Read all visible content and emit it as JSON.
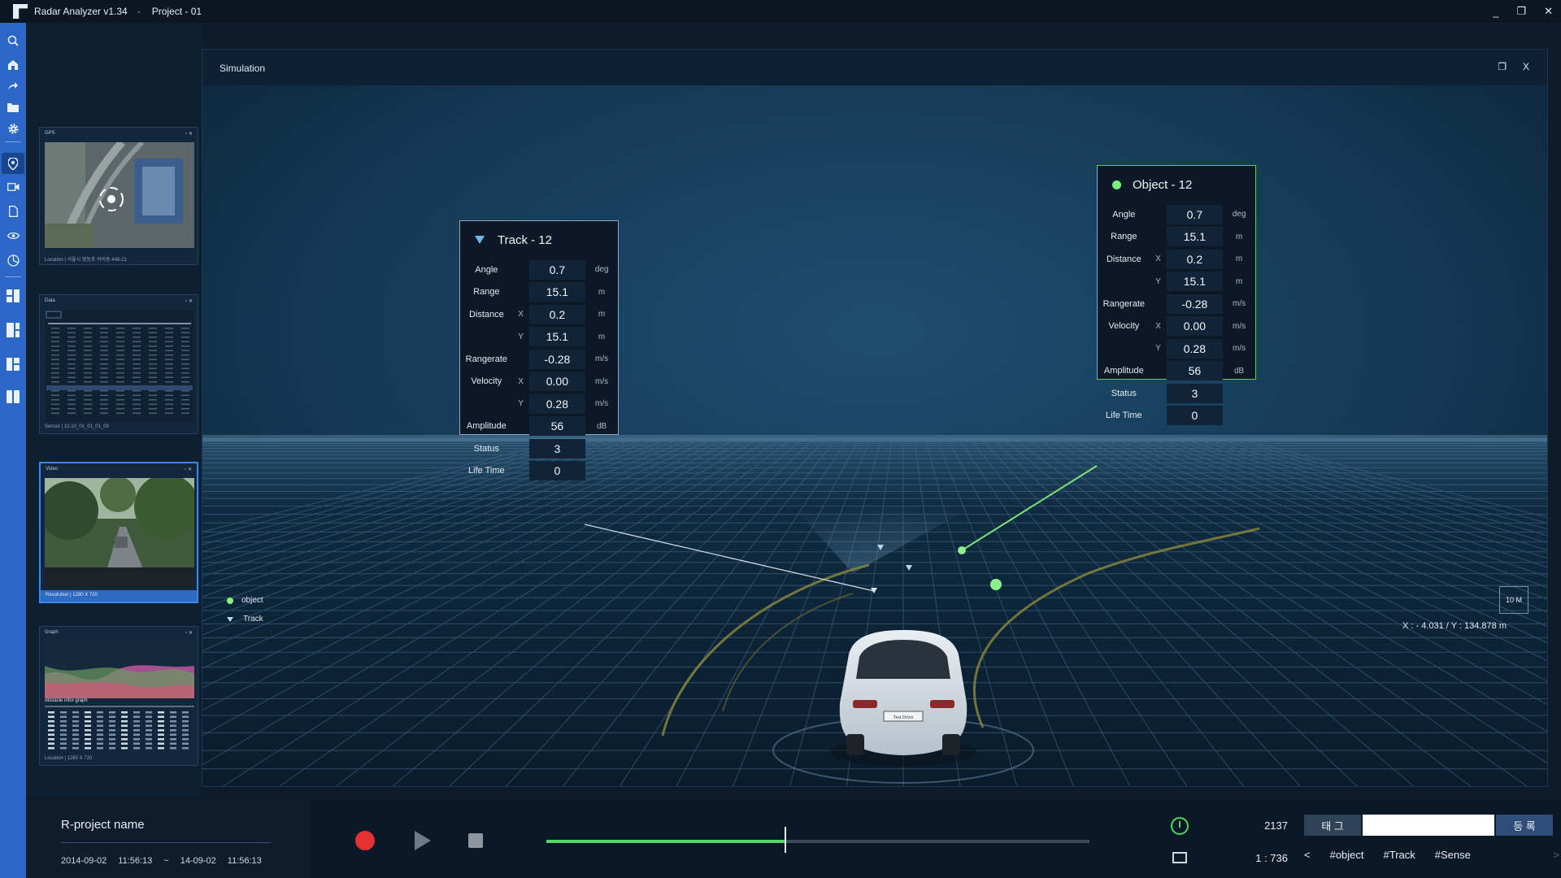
{
  "app": {
    "title": "Radar Analyzer v1.34",
    "separator": "-",
    "project": "Project - 01",
    "window_buttons": {
      "minimize": "_",
      "restore": "❐",
      "close": "✕"
    }
  },
  "rail": {
    "icons": [
      "search-icon",
      "home-icon",
      "share-icon",
      "folder-icon",
      "gear-icon",
      "location-pin-icon",
      "video-camera-icon",
      "document-icon",
      "eye-icon",
      "chart-icon",
      "layout-grid-icon",
      "layout-split-icon",
      "layout-tiles-icon",
      "layout-columns-icon"
    ],
    "active": "location-pin-icon"
  },
  "thumbnails": {
    "gps": {
      "title": "GPS",
      "footer": "Location  |  서울시 영등포 여의동 448-21"
    },
    "data": {
      "title": "Data",
      "footer": "Sensor  |  10.10_01_01_01_00"
    },
    "video": {
      "title": "Video",
      "footer": "Resolution  |  1280 X 720"
    },
    "graph": {
      "title": "Graph",
      "subtitle": "obstacle infor graph",
      "footer": "Location  |  1280 X 720"
    }
  },
  "simulation": {
    "title": "Simulation",
    "buttons": {
      "restore": "❐",
      "close": "X"
    },
    "track_panel": {
      "title": "Track - 12",
      "rows": [
        {
          "label": "Angle",
          "axis": "",
          "value": "0.7",
          "unit": "deg"
        },
        {
          "label": "Range",
          "axis": "",
          "value": "15.1",
          "unit": "m"
        },
        {
          "label": "Distance",
          "axis": "X",
          "value": "0.2",
          "unit": "m"
        },
        {
          "label": "",
          "axis": "Y",
          "value": "15.1",
          "unit": "m"
        },
        {
          "label": "Rangerate",
          "axis": "",
          "value": "-0.28",
          "unit": "m/s"
        },
        {
          "label": "Velocity",
          "axis": "X",
          "value": "0.00",
          "unit": "m/s"
        },
        {
          "label": "",
          "axis": "Y",
          "value": "0.28",
          "unit": "m/s"
        },
        {
          "label": "Amplitude",
          "axis": "",
          "value": "56",
          "unit": "dB"
        },
        {
          "label": "Status",
          "axis": "",
          "value": "3",
          "unit": ""
        },
        {
          "label": "Life Time",
          "axis": "",
          "value": "0",
          "unit": ""
        }
      ]
    },
    "object_panel": {
      "title": "Object - 12",
      "rows": [
        {
          "label": "Angle",
          "axis": "",
          "value": "0.7",
          "unit": "deg"
        },
        {
          "label": "Range",
          "axis": "",
          "value": "15.1",
          "unit": "m"
        },
        {
          "label": "Distance",
          "axis": "X",
          "value": "0.2",
          "unit": "m"
        },
        {
          "label": "",
          "axis": "Y",
          "value": "15.1",
          "unit": "m"
        },
        {
          "label": "Rangerate",
          "axis": "",
          "value": "-0.28",
          "unit": "m/s"
        },
        {
          "label": "Velocity",
          "axis": "X",
          "value": "0.00",
          "unit": "m/s"
        },
        {
          "label": "",
          "axis": "Y",
          "value": "0.28",
          "unit": "m/s"
        },
        {
          "label": "Amplitude",
          "axis": "",
          "value": "56",
          "unit": "dB"
        },
        {
          "label": "Status",
          "axis": "",
          "value": "3",
          "unit": ""
        },
        {
          "label": "Life Time",
          "axis": "",
          "value": "0",
          "unit": ""
        }
      ]
    },
    "legend": {
      "object": "object",
      "track": "Track"
    },
    "scale": "10 M",
    "coordinates": "X :  - 4.031    /  Y :  134.878   m",
    "car_plate": "Test Drive"
  },
  "bottom": {
    "project_name": "R-project name",
    "start_date": "2014-09-02",
    "start_time": "11:56:13",
    "range_sep": "~",
    "end_date": "14-09-02",
    "end_time": "11:56:13",
    "progress": 0.44,
    "elapsed": "2137",
    "frame": "1  :  736",
    "tag_label": "태 그",
    "tag_placeholder": "",
    "register_label": "등 록",
    "tags": [
      "#object",
      "#Track",
      "#Sense"
    ],
    "prev": "<",
    "next": ">"
  },
  "colors": {
    "rail": "#2b67c6",
    "accent_green": "#55d468",
    "record_red": "#e43232"
  }
}
